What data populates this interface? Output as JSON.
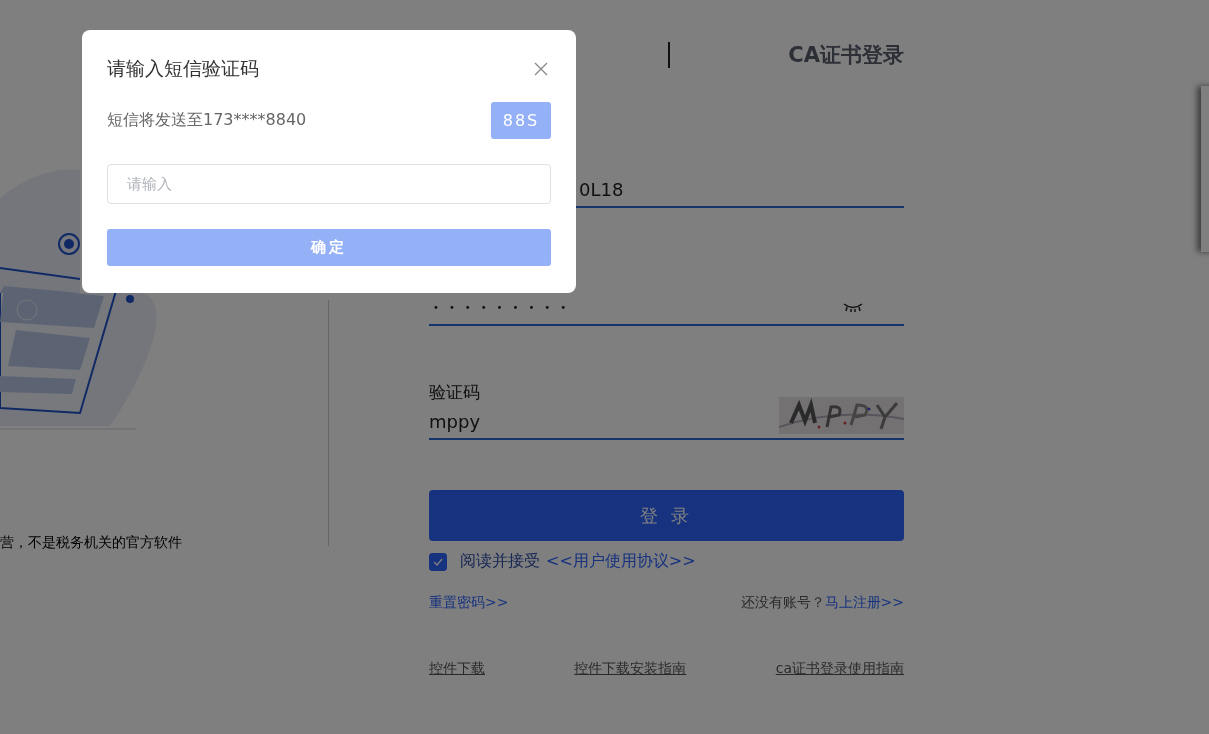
{
  "header": {
    "ca_tab": "CA证书登录"
  },
  "notice": "营，不是税务机关的官方软件",
  "form": {
    "username": {
      "value": "0L18"
    },
    "password": {
      "mask": "•••••••••"
    },
    "captcha": {
      "label": "验证码",
      "value": "mppy"
    },
    "login_button": "登 录",
    "agreement": {
      "checked": true,
      "text": "阅读并接受",
      "link": "<<用户使用协议>>"
    },
    "reset_link": "重置密码>>",
    "register_prompt": "还没有账号？",
    "register_link": "马上注册>>",
    "bottom_links": [
      "控件下载",
      "控件下载安装指南",
      "ca证书登录使用指南"
    ]
  },
  "dialog": {
    "title": "请输入短信验证码",
    "phone_text": "短信将发送至173****8840",
    "countdown": "88S",
    "code_field": {
      "placeholder": "请输入"
    },
    "confirm": "确定"
  }
}
